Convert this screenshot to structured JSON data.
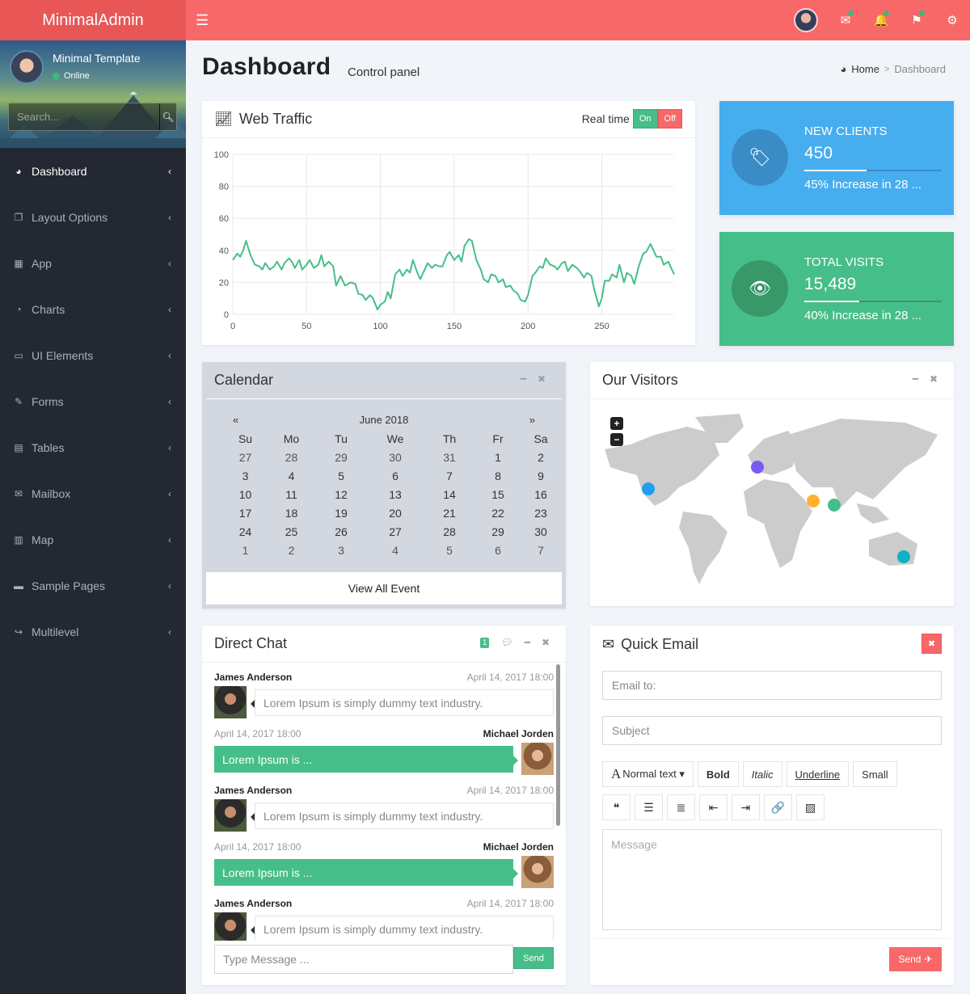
{
  "app": {
    "logo": "MinimalAdmin"
  },
  "topbar": {
    "menu_icon": "hamburger-icon",
    "icons": [
      {
        "name": "envelope-icon",
        "glyph": "✉",
        "notification": true
      },
      {
        "name": "bell-icon",
        "glyph": "🔔",
        "notification": true
      },
      {
        "name": "flag-icon",
        "glyph": "⚑",
        "notification": true
      },
      {
        "name": "gear-icon",
        "glyph": "⚙",
        "notification": false
      }
    ],
    "notification_dot_color": "#3fb67a"
  },
  "sidebar": {
    "user": {
      "name": "Minimal Template",
      "status": "Online"
    },
    "search": {
      "placeholder": "Search..."
    },
    "items": [
      {
        "label": "Dashboard",
        "icon": "dashboard-icon",
        "glyph": "◕",
        "active": true
      },
      {
        "label": "Layout Options",
        "icon": "copy-icon",
        "glyph": "❐",
        "active": false
      },
      {
        "label": "App",
        "icon": "grid-icon",
        "glyph": "▦",
        "active": false
      },
      {
        "label": "Charts",
        "icon": "pie-chart-icon",
        "glyph": "◔",
        "active": false
      },
      {
        "label": "UI Elements",
        "icon": "laptop-icon",
        "glyph": "▭",
        "active": false
      },
      {
        "label": "Forms",
        "icon": "edit-icon",
        "glyph": "✎",
        "active": false
      },
      {
        "label": "Tables",
        "icon": "table-icon",
        "glyph": "▤",
        "active": false
      },
      {
        "label": "Mailbox",
        "icon": "envelope-icon",
        "glyph": "✉",
        "active": false
      },
      {
        "label": "Map",
        "icon": "map-icon",
        "glyph": "▥",
        "active": false
      },
      {
        "label": "Sample Pages",
        "icon": "folder-icon",
        "glyph": "▬",
        "active": false
      },
      {
        "label": "Multilevel",
        "icon": "share-icon",
        "glyph": "↪",
        "active": false
      }
    ],
    "chevron": "‹"
  },
  "header": {
    "title": "Dashboard",
    "subtitle": "Control panel",
    "breadcrumb": {
      "home": "Home",
      "separator": ">",
      "current": "Dashboard"
    }
  },
  "web_traffic": {
    "title": "Web Traffic",
    "realtime_label": "Real time",
    "on_label": "On",
    "off_label": "Off"
  },
  "stats": [
    {
      "title": "NEW CLIENTS",
      "value": "450",
      "progress": 45,
      "description": "45% Increase in 28 ...",
      "icon": "tag-icon",
      "color": "#46adef"
    },
    {
      "title": "TOTAL VISITS",
      "value": "15,489",
      "progress": 40,
      "description": "40% Increase in 28 ...",
      "icon": "eye-icon",
      "color": "#46be8a"
    }
  ],
  "calendar": {
    "title": "Calendar",
    "month": "June 2018",
    "prev": "«",
    "next": "»",
    "weekdays": [
      "Su",
      "Mo",
      "Tu",
      "We",
      "Th",
      "Fr",
      "Sa"
    ],
    "weeks": [
      [
        {
          "d": "27",
          "m": true
        },
        {
          "d": "28",
          "m": true
        },
        {
          "d": "29",
          "m": true
        },
        {
          "d": "30",
          "m": true
        },
        {
          "d": "31",
          "m": true
        },
        {
          "d": "1"
        },
        {
          "d": "2"
        }
      ],
      [
        {
          "d": "3"
        },
        {
          "d": "4"
        },
        {
          "d": "5"
        },
        {
          "d": "6"
        },
        {
          "d": "7"
        },
        {
          "d": "8"
        },
        {
          "d": "9"
        }
      ],
      [
        {
          "d": "10"
        },
        {
          "d": "11"
        },
        {
          "d": "12"
        },
        {
          "d": "13"
        },
        {
          "d": "14"
        },
        {
          "d": "15"
        },
        {
          "d": "16"
        }
      ],
      [
        {
          "d": "17"
        },
        {
          "d": "18"
        },
        {
          "d": "19"
        },
        {
          "d": "20"
        },
        {
          "d": "21"
        },
        {
          "d": "22"
        },
        {
          "d": "23"
        }
      ],
      [
        {
          "d": "24"
        },
        {
          "d": "25"
        },
        {
          "d": "26"
        },
        {
          "d": "27"
        },
        {
          "d": "28"
        },
        {
          "d": "29"
        },
        {
          "d": "30"
        }
      ],
      [
        {
          "d": "1",
          "m": true
        },
        {
          "d": "2",
          "m": true
        },
        {
          "d": "3",
          "m": true
        },
        {
          "d": "4",
          "m": true
        },
        {
          "d": "5",
          "m": true
        },
        {
          "d": "6",
          "m": true
        },
        {
          "d": "7",
          "m": true
        }
      ]
    ],
    "footer": "View All Event"
  },
  "visitors": {
    "title": "Our Visitors",
    "zoom_in": "+",
    "zoom_out": "−",
    "markers": [
      {
        "region": "US West Coast",
        "color": "#1e9ff2"
      },
      {
        "region": "United Kingdom",
        "color": "#7a5af5"
      },
      {
        "region": "Middle East",
        "color": "#ffb22b"
      },
      {
        "region": "India",
        "color": "#46be8a"
      },
      {
        "region": "Australia",
        "color": "#0fb1c4"
      }
    ]
  },
  "chat": {
    "title": "Direct Chat",
    "badge": "1",
    "messages": [
      {
        "side": "left",
        "name": "James Anderson",
        "time": "April 14, 2017 18:00",
        "text": "Lorem Ipsum is simply dummy text industry."
      },
      {
        "side": "right",
        "name": "Michael Jorden",
        "time": "April 14, 2017 18:00",
        "text": "Lorem Ipsum is ..."
      },
      {
        "side": "left",
        "name": "James Anderson",
        "time": "April 14, 2017 18:00",
        "text": "Lorem Ipsum is simply dummy text industry."
      },
      {
        "side": "right",
        "name": "Michael Jorden",
        "time": "April 14, 2017 18:00",
        "text": "Lorem Ipsum is ..."
      },
      {
        "side": "left",
        "name": "James Anderson",
        "time": "April 14, 2017 18:00",
        "text": "Lorem Ipsum is simply dummy text industry."
      }
    ],
    "input_placeholder": "Type Message ...",
    "send_label": "Send"
  },
  "email": {
    "title": "Quick Email",
    "to_placeholder": "Email to:",
    "subject_placeholder": "Subject",
    "format_buttons": [
      {
        "label": "Normal text ▾",
        "name": "font-style-dropdown"
      },
      {
        "label": "Bold",
        "name": "bold-button"
      },
      {
        "label": "Italic",
        "name": "italic-button"
      },
      {
        "label": "Underline",
        "name": "underline-button"
      },
      {
        "label": "Small",
        "name": "small-button"
      }
    ],
    "icon_buttons": [
      {
        "name": "quote-icon",
        "glyph": "❝"
      },
      {
        "name": "unordered-list-icon",
        "glyph": "☰"
      },
      {
        "name": "ordered-list-icon",
        "glyph": "≣"
      },
      {
        "name": "outdent-icon",
        "glyph": "⇤"
      },
      {
        "name": "indent-icon",
        "glyph": "⇥"
      },
      {
        "name": "link-icon",
        "glyph": "🔗"
      },
      {
        "name": "image-icon",
        "glyph": "▨"
      }
    ],
    "message_placeholder": "Message",
    "send_label": "Send"
  },
  "chart_data": {
    "type": "line",
    "title": "Web Traffic",
    "xlabel": "",
    "ylabel": "",
    "xlim": [
      0,
      299
    ],
    "ylim": [
      0,
      100
    ],
    "xticks": [
      0,
      50,
      100,
      150,
      200,
      250
    ],
    "yticks": [
      0,
      20,
      40,
      60,
      80,
      100
    ],
    "grid": true,
    "series": [
      {
        "name": "traffic",
        "color": "#46be8a",
        "x": [
          0,
          3,
          5,
          7,
          9,
          12,
          15,
          18,
          20,
          22,
          25,
          28,
          30,
          33,
          35,
          38,
          40,
          42,
          45,
          47,
          50,
          52,
          55,
          58,
          60,
          62,
          65,
          68,
          70,
          73,
          76,
          80,
          83,
          85,
          88,
          90,
          93,
          95,
          98,
          100,
          103,
          105,
          107,
          110,
          113,
          115,
          118,
          120,
          122,
          125,
          127,
          130,
          132,
          135,
          137,
          140,
          142,
          145,
          147,
          150,
          153,
          155,
          157,
          160,
          162,
          165,
          168,
          170,
          173,
          175,
          178,
          180,
          183,
          185,
          188,
          190,
          193,
          195,
          198,
          200,
          203,
          205,
          208,
          210,
          212,
          215,
          218,
          220,
          223,
          225,
          227,
          230,
          233,
          235,
          238,
          240,
          243,
          245,
          248,
          250,
          252,
          255,
          257,
          260,
          262,
          265,
          267,
          270,
          272,
          275,
          278,
          280,
          283,
          285,
          287,
          290,
          292,
          295,
          297,
          299
        ],
        "y": [
          34,
          38,
          36,
          40,
          46,
          37,
          31,
          30,
          28,
          32,
          28,
          30,
          33,
          28,
          32,
          35,
          33,
          29,
          34,
          28,
          31,
          34,
          29,
          31,
          37,
          30,
          33,
          30,
          18,
          24,
          18,
          20,
          19,
          13,
          12,
          9,
          12,
          10,
          3,
          6,
          8,
          14,
          10,
          25,
          28,
          24,
          28,
          26,
          34,
          26,
          22,
          28,
          32,
          29,
          31,
          30,
          30,
          37,
          39,
          34,
          37,
          33,
          43,
          47,
          46,
          34,
          28,
          22,
          20,
          25,
          24,
          20,
          22,
          17,
          18,
          15,
          13,
          9,
          8,
          12,
          24,
          26,
          30,
          29,
          35,
          31,
          30,
          28,
          32,
          33,
          27,
          31,
          29,
          27,
          23,
          26,
          24,
          15,
          5,
          10,
          21,
          21,
          25,
          23,
          31,
          20,
          26,
          24,
          19,
          30,
          38,
          39,
          44,
          40,
          36,
          36,
          31,
          33,
          29,
          25
        ]
      }
    ]
  }
}
